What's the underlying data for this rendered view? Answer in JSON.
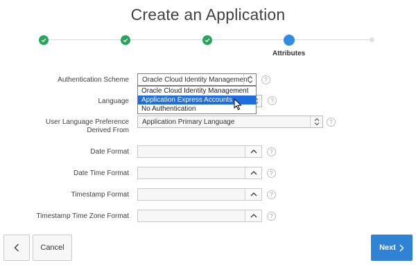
{
  "title": "Create an Application",
  "wizard": {
    "current_step_label": "Attributes"
  },
  "form": {
    "authentication_scheme": {
      "label": "Authentication Scheme",
      "value": "Oracle Cloud Identity Management",
      "options": [
        "Oracle Cloud Identity Management",
        "Application Express Accounts",
        "No Authentication"
      ],
      "highlighted": "Application Express Accounts"
    },
    "language": {
      "label": "Language"
    },
    "user_language_preference": {
      "label": "User Language Preference Derived From",
      "value": "Application Primary Language"
    },
    "date_format": {
      "label": "Date Format",
      "value": ""
    },
    "date_time_format": {
      "label": "Date Time Format",
      "value": ""
    },
    "timestamp_format": {
      "label": "Timestamp Format",
      "value": ""
    },
    "timestamp_tz_format": {
      "label": "Timestamp Time Zone Format",
      "value": ""
    }
  },
  "footer": {
    "cancel_label": "Cancel",
    "next_label": "Next"
  },
  "colors": {
    "completed": "#26a65b",
    "current": "#2f8ce0",
    "primary_button": "#2f82d4",
    "highlight": "#1e6ee0"
  }
}
